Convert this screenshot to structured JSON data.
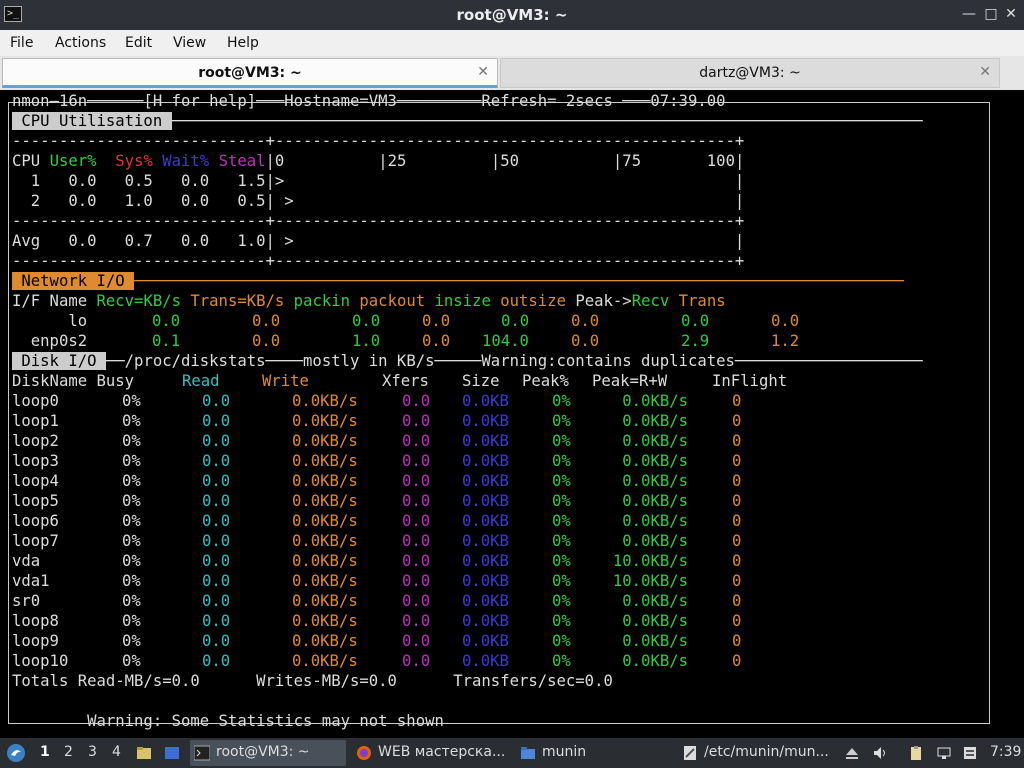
{
  "window": {
    "title": "root@VM3: ~"
  },
  "menu": [
    "File",
    "Actions",
    "Edit",
    "View",
    "Help"
  ],
  "tabs": [
    {
      "label": "root@VM3: ~",
      "active": true
    },
    {
      "label": "dartz@VM3: ~",
      "active": false
    }
  ],
  "nmon": {
    "header": "nmon‒16n──────[H for help]───Hostname=VM3─────────Refresh= 2secs ───07:39.00",
    "cpu": {
      "section": " CPU Utilisation ",
      "sep": "---------------------------+-------------------------------------------------+",
      "head": {
        "cpu": "CPU ",
        "user": "User%",
        "sys": "Sys%",
        "wait": "Wait%",
        "steal": "Steal",
        "scale": "|0          |25         |50          |75       100|"
      },
      "rows": [
        "  1   0.0   0.5   0.0   1.5|>                                                |",
        "  2   0.0   1.0   0.0   0.5| >                                               |"
      ],
      "avg": "Avg   0.0   0.7   0.0   1.0| >                                               |"
    },
    "net": {
      "section": " Network I/O ",
      "head": {
        "ifname": "I/F Name ",
        "recv": "Recv=KB/s",
        "trans": "Trans=KB/s",
        "packin": "packin",
        "packout": "packout",
        "insize": "insize",
        "outsize": "outsize",
        "peak": "Peak->",
        "precv": "Recv",
        "ptrans": "Trans"
      },
      "rows": [
        {
          "name": "      lo",
          "recv": "0.0",
          "trans": "0.0",
          "packin": "0.0",
          "packout": "0.0",
          "insize": "0.0",
          "outsize": "0.0",
          "precv": "0.0",
          "ptrans": "0.0"
        },
        {
          "name": "  enp0s2",
          "recv": "0.1",
          "trans": "0.0",
          "packin": "1.0",
          "packout": "0.0",
          "insize": "104.0",
          "outsize": "0.0",
          "precv": "2.9",
          "ptrans": "1.2"
        }
      ]
    },
    "disk": {
      "section": " Disk I/O ",
      "section_tail": "──/proc/diskstats────mostly in KB/s─────Warning:contains duplicates────────────────────",
      "head": {
        "name": "DiskName Busy",
        "read": "Read",
        "write": "Write",
        "xfers": "Xfers",
        "size": "Size",
        "peakp": "Peak%",
        "peakrw": "Peak=R+W",
        "inflight": "InFlight"
      },
      "rows": [
        {
          "name": "loop0",
          "busy": "0%",
          "read": "0.0",
          "write": "0.0KB/s",
          "xfers": "0.0",
          "size": "0.0KB",
          "peakp": "0%",
          "peakrw": "0.0KB/s",
          "inflight": "0"
        },
        {
          "name": "loop1",
          "busy": "0%",
          "read": "0.0",
          "write": "0.0KB/s",
          "xfers": "0.0",
          "size": "0.0KB",
          "peakp": "0%",
          "peakrw": "0.0KB/s",
          "inflight": "0"
        },
        {
          "name": "loop2",
          "busy": "0%",
          "read": "0.0",
          "write": "0.0KB/s",
          "xfers": "0.0",
          "size": "0.0KB",
          "peakp": "0%",
          "peakrw": "0.0KB/s",
          "inflight": "0"
        },
        {
          "name": "loop3",
          "busy": "0%",
          "read": "0.0",
          "write": "0.0KB/s",
          "xfers": "0.0",
          "size": "0.0KB",
          "peakp": "0%",
          "peakrw": "0.0KB/s",
          "inflight": "0"
        },
        {
          "name": "loop4",
          "busy": "0%",
          "read": "0.0",
          "write": "0.0KB/s",
          "xfers": "0.0",
          "size": "0.0KB",
          "peakp": "0%",
          "peakrw": "0.0KB/s",
          "inflight": "0"
        },
        {
          "name": "loop5",
          "busy": "0%",
          "read": "0.0",
          "write": "0.0KB/s",
          "xfers": "0.0",
          "size": "0.0KB",
          "peakp": "0%",
          "peakrw": "0.0KB/s",
          "inflight": "0"
        },
        {
          "name": "loop6",
          "busy": "0%",
          "read": "0.0",
          "write": "0.0KB/s",
          "xfers": "0.0",
          "size": "0.0KB",
          "peakp": "0%",
          "peakrw": "0.0KB/s",
          "inflight": "0"
        },
        {
          "name": "loop7",
          "busy": "0%",
          "read": "0.0",
          "write": "0.0KB/s",
          "xfers": "0.0",
          "size": "0.0KB",
          "peakp": "0%",
          "peakrw": "0.0KB/s",
          "inflight": "0"
        },
        {
          "name": "vda",
          "busy": "0%",
          "read": "0.0",
          "write": "0.0KB/s",
          "xfers": "0.0",
          "size": "0.0KB",
          "peakp": "0%",
          "peakrw": "10.0KB/s",
          "inflight": "0"
        },
        {
          "name": "vda1",
          "busy": "0%",
          "read": "0.0",
          "write": "0.0KB/s",
          "xfers": "0.0",
          "size": "0.0KB",
          "peakp": "0%",
          "peakrw": "10.0KB/s",
          "inflight": "0"
        },
        {
          "name": "sr0",
          "busy": "0%",
          "read": "0.0",
          "write": "0.0KB/s",
          "xfers": "0.0",
          "size": "0.0KB",
          "peakp": "0%",
          "peakrw": "0.0KB/s",
          "inflight": "0"
        },
        {
          "name": "loop8",
          "busy": "0%",
          "read": "0.0",
          "write": "0.0KB/s",
          "xfers": "0.0",
          "size": "0.0KB",
          "peakp": "0%",
          "peakrw": "0.0KB/s",
          "inflight": "0"
        },
        {
          "name": "loop9",
          "busy": "0%",
          "read": "0.0",
          "write": "0.0KB/s",
          "xfers": "0.0",
          "size": "0.0KB",
          "peakp": "0%",
          "peakrw": "0.0KB/s",
          "inflight": "0"
        },
        {
          "name": "loop10",
          "busy": "0%",
          "read": "0.0",
          "write": "0.0KB/s",
          "xfers": "0.0",
          "size": "0.0KB",
          "peakp": "0%",
          "peakrw": "0.0KB/s",
          "inflight": "0"
        }
      ],
      "totals": "Totals Read-MB/s=0.0      Writes-MB/s=0.0      Transfers/sec=0.0"
    },
    "warning": "        Warning: Some Statistics may not shown"
  },
  "taskbar": {
    "workspaces": [
      "1",
      "2",
      "3",
      "4"
    ],
    "items": [
      {
        "label": "root@VM3: ~",
        "icon": "terminal-icon"
      },
      {
        "label": "WEB мастерска...",
        "icon": "firefox-icon"
      },
      {
        "label": "munin",
        "icon": "folder-icon"
      },
      {
        "label": "/etc/munin/mun...",
        "icon": "text-editor-icon"
      }
    ],
    "clock": "7:39"
  }
}
